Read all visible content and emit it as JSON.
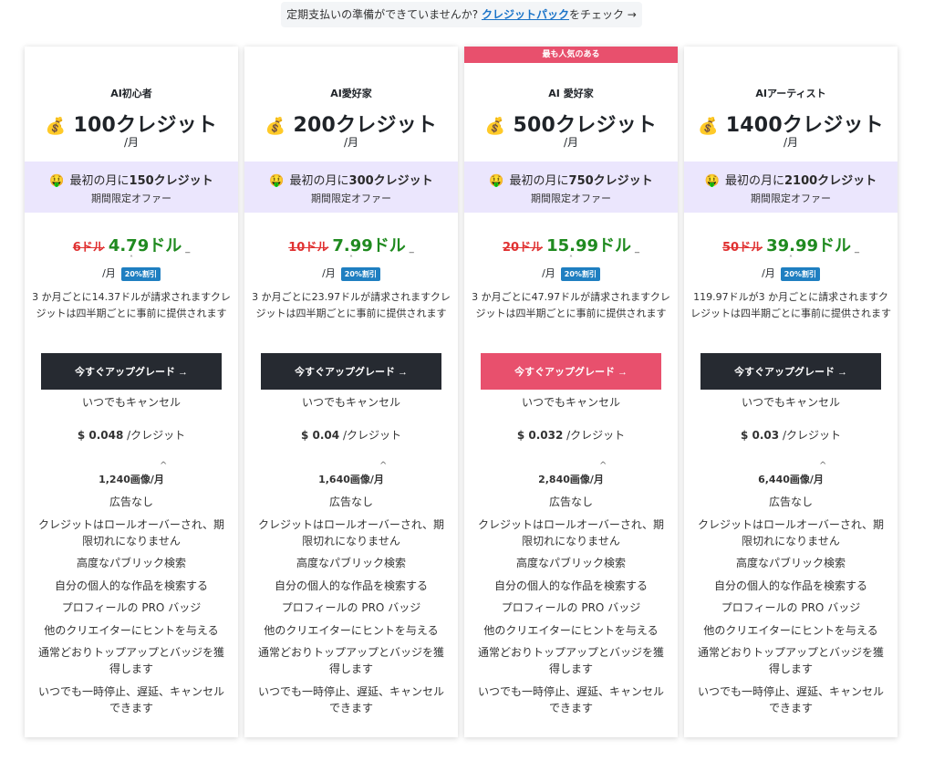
{
  "notice": {
    "text": "定期支払いの準備ができていませんか?",
    "link": "クレジットパック",
    "suffix": "をチェック →"
  },
  "cards": [
    {
      "name": "AI初心者",
      "credits": "100クレジット",
      "per_month": "/月",
      "offer": {
        "prefix": "最初の月に",
        "amount": "150クレジット",
        "sub": "期間限定オファー"
      },
      "old_price": "6ドル",
      "new_price": "4.79ドル",
      "discount_badge": "20%割引",
      "billing": "3 か月ごとに14.37ドルが請求されますクレジットは四半期ごとに事前に提供されます",
      "cta": "今すぐアップグレード →",
      "cancel": "いつでもキャンセル",
      "unit_value": "$ 0.048",
      "unit_suffix": "/クレジット",
      "images": "1,240画像/月"
    },
    {
      "name": "AI愛好家",
      "credits": "200クレジット",
      "per_month": "/月",
      "offer": {
        "prefix": "最初の月に",
        "amount": "300クレジット",
        "sub": "期間限定オファー"
      },
      "old_price": "10ドル",
      "new_price": "7.99ドル",
      "discount_badge": "20%割引",
      "billing": "3 か月ごとに23.97ドルが請求されますクレジットは四半期ごとに事前に提供されます",
      "cta": "今すぐアップグレード →",
      "cancel": "いつでもキャンセル",
      "unit_value": "$ 0.04",
      "unit_suffix": "/クレジット",
      "images": "1,640画像/月"
    },
    {
      "banner": "最も人気のある",
      "name": "AI 愛好家",
      "credits": "500クレジット",
      "per_month": "/月",
      "offer": {
        "prefix": "最初の月に",
        "amount": "750クレジット",
        "sub": "期間限定オファー"
      },
      "old_price": "20ドル",
      "new_price": "15.99ドル",
      "discount_badge": "20%割引",
      "billing": "3 か月ごとに47.97ドルが請求されますクレジットは四半期ごとに事前に提供されます",
      "cta": "今すぐアップグレード →",
      "cancel": "いつでもキャンセル",
      "unit_value": "$ 0.032",
      "unit_suffix": "/クレジット",
      "images": "2,840画像/月"
    },
    {
      "name": "AIアーティスト",
      "credits": "1400クレジット",
      "per_month": "/月",
      "offer": {
        "prefix": "最初の月に",
        "amount": "2100クレジット",
        "sub": "期間限定オファー"
      },
      "old_price": "50ドル",
      "new_price": "39.99ドル",
      "discount_badge": "20%割引",
      "billing": "119.97ドルが3 か月ごとに請求されますクレジットは四半期ごとに事前に提供されます",
      "cta": "今すぐアップグレード →",
      "cancel": "いつでもキャンセル",
      "unit_value": "$ 0.03",
      "unit_suffix": "/クレジット",
      "images": "6,440画像/月"
    }
  ],
  "features": [
    "広告なし",
    "クレジットはロールオーバーされ、期限切れになりません",
    "高度なパブリック検索",
    "自分の個人的な作品を検索する",
    "プロフィールの PRO バッジ",
    "他のクリエイターにヒントを与える",
    "通常どおりトップアップとバッジを獲得します",
    "いつでも一時停止、遅延、キャンセルできます"
  ],
  "icons": {
    "bag": "money-bag-icon",
    "offer": "money-face-icon",
    "caret": "caret-up-icon"
  },
  "colors": {
    "accent": "#e8506d",
    "dark_button": "#262a31",
    "offer_bg": "#ebe6fd",
    "new_price": "#1f8a1f",
    "old_price": "#e03131",
    "badge": "#1f7fc1"
  }
}
